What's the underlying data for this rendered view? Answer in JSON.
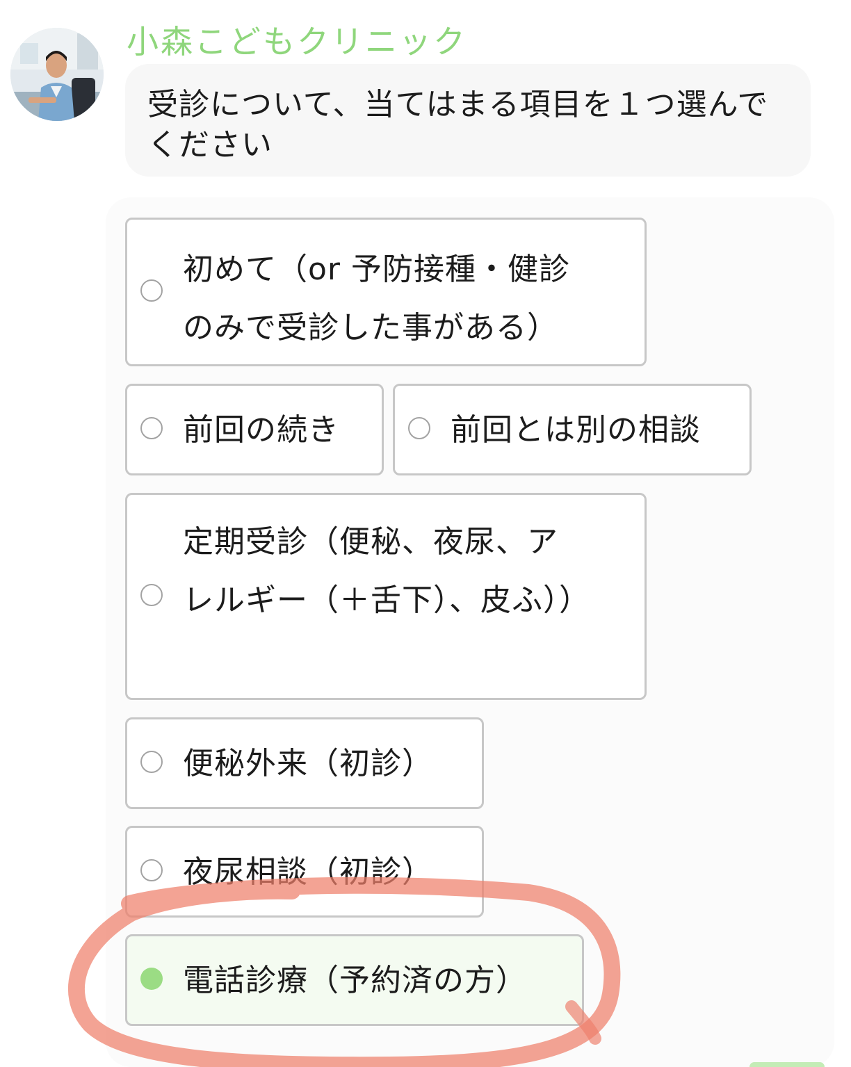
{
  "header": {
    "sender_name": "小森こどもクリニック"
  },
  "message": {
    "prompt": "受診について、当てはまる項目を１つ選んでください"
  },
  "options": [
    {
      "label": "初めて（or 予防接種・健診のみで受診した事がある）",
      "selected": false
    },
    {
      "label": "前回の続き",
      "selected": false
    },
    {
      "label": "前回とは別の相談",
      "selected": false
    },
    {
      "label": "定期受診（便秘、夜尿、アレルギー（＋舌下）、皮ふ））",
      "selected": false
    },
    {
      "label": "便秘外来（初診）",
      "selected": false
    },
    {
      "label": "夜尿相談（初診）",
      "selected": false
    },
    {
      "label": "電話診療（予約済の方）",
      "selected": true
    }
  ],
  "colors": {
    "accent_green": "#8fd67c",
    "selected_radio": "#9bdc84",
    "annotation_stroke": "#ee7f6b"
  },
  "icons": {
    "avatar": "doctor-photo",
    "annotation": "hand-drawn-circle"
  }
}
